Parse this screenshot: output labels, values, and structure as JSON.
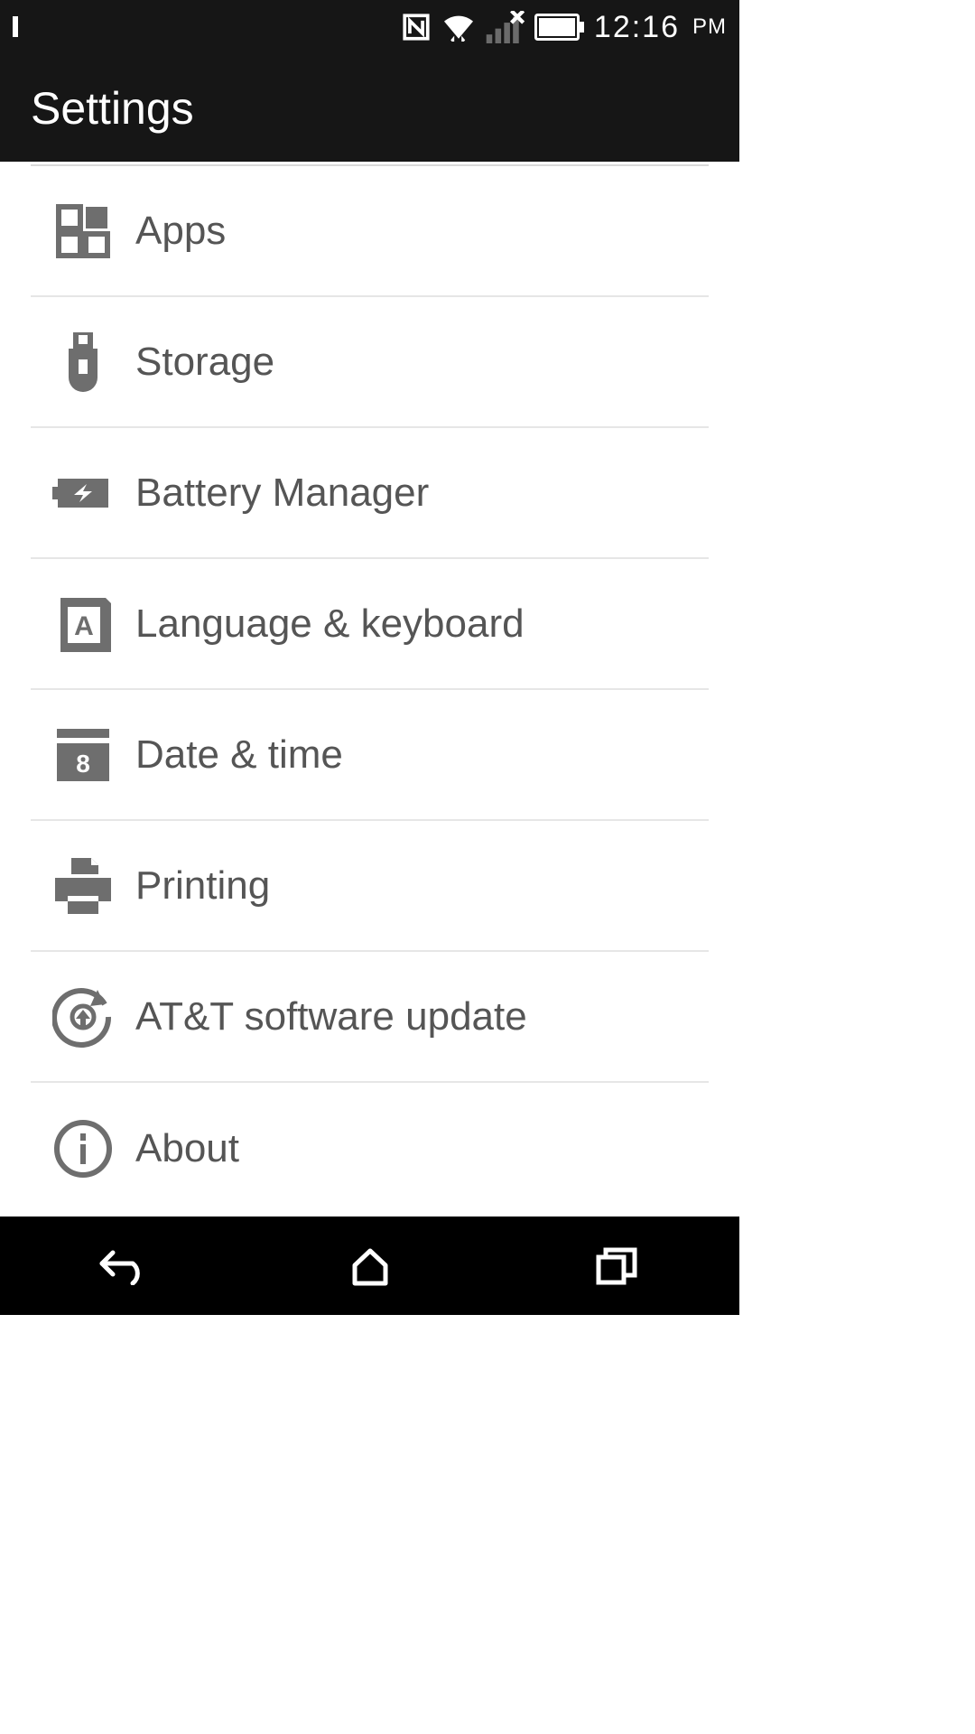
{
  "status": {
    "time": "12:16",
    "ampm": "PM"
  },
  "header": {
    "title": "Settings"
  },
  "items": [
    {
      "label": "Apps"
    },
    {
      "label": "Storage"
    },
    {
      "label": "Battery Manager"
    },
    {
      "label": "Language & keyboard"
    },
    {
      "label": "Date & time"
    },
    {
      "label": "Printing"
    },
    {
      "label": "AT&T software update"
    },
    {
      "label": "About"
    }
  ]
}
